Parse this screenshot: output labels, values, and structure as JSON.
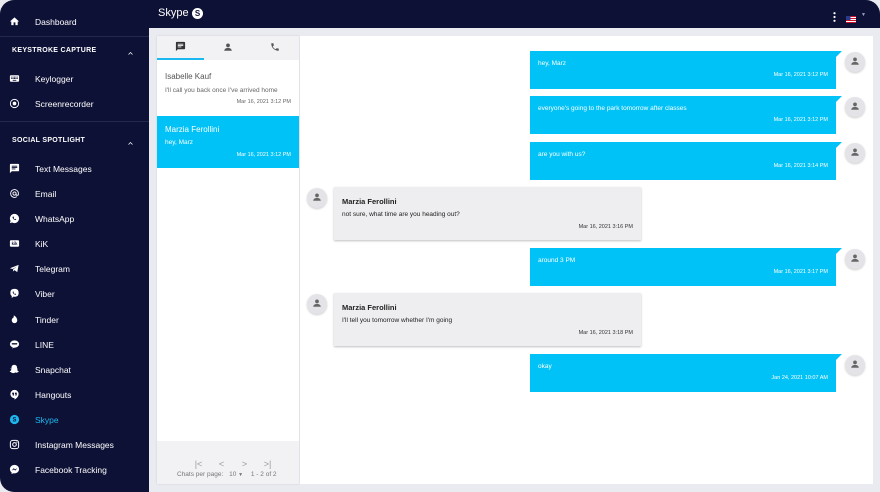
{
  "topbar": {
    "title": "Skype",
    "badge": "S"
  },
  "sidebar": {
    "dashboard": "Dashboard",
    "keystroke_section": "KEYSTROKE CAPTURE",
    "keylogger": "Keylogger",
    "screenrecorder": "Screenrecorder",
    "social_section": "SOCIAL SPOTLIGHT",
    "items": [
      {
        "label": "Text Messages",
        "icon": "message-icon"
      },
      {
        "label": "Email",
        "icon": "at-icon"
      },
      {
        "label": "WhatsApp",
        "icon": "whatsapp-icon"
      },
      {
        "label": "KiK",
        "icon": "kik-icon"
      },
      {
        "label": "Telegram",
        "icon": "telegram-icon"
      },
      {
        "label": "Viber",
        "icon": "viber-icon"
      },
      {
        "label": "Tinder",
        "icon": "tinder-icon"
      },
      {
        "label": "LINE",
        "icon": "line-icon"
      },
      {
        "label": "Snapchat",
        "icon": "snapchat-icon"
      },
      {
        "label": "Hangouts",
        "icon": "hangouts-icon"
      },
      {
        "label": "Skype",
        "icon": "skype-icon"
      },
      {
        "label": "Instagram Messages",
        "icon": "instagram-icon"
      },
      {
        "label": "Facebook Tracking",
        "icon": "messenger-icon"
      }
    ],
    "active_item": "Skype"
  },
  "chat_list": {
    "chats": [
      {
        "name": "Isabelle Kauf",
        "preview": "I'll call you back once I've arrived home",
        "time": "Mar 16, 2021 3:12 PM"
      },
      {
        "name": "Marzia Ferollini",
        "preview": "hey, Marz",
        "time": "Mar 16, 2021 3:12 PM"
      }
    ],
    "pager": {
      "per_page_label": "Chats per page:",
      "per_page": "10",
      "range": "1 - 2 of 2"
    }
  },
  "messages": [
    {
      "dir": "out",
      "text": "hey, Marz",
      "time": "Mar 16, 2021 3:12 PM"
    },
    {
      "dir": "out",
      "text": "everyone's going to the park tomorrow after classes",
      "time": "Mar 16, 2021 3:12 PM"
    },
    {
      "dir": "out",
      "text": "are you with us?",
      "time": "Mar 16, 2021 3:14 PM"
    },
    {
      "dir": "in",
      "sender": "Marzia Ferollini",
      "text": "not sure, what time are you heading out?",
      "time": "Mar 16, 2021 3:16 PM"
    },
    {
      "dir": "out",
      "text": "around 3 PM",
      "time": "Mar 16, 2021 3:17 PM"
    },
    {
      "dir": "in",
      "sender": "Marzia Ferollini",
      "text": "I'll tell you tomorrow whether I'm going",
      "time": "Mar 16, 2021 3:18 PM"
    },
    {
      "dir": "out",
      "text": "okay",
      "time": "Jan 24, 2021 10:07 AM"
    }
  ],
  "colors": {
    "navy": "#0e1136",
    "accent": "#1cb8f0",
    "bubble_out": "#00c2f7",
    "bubble_in": "#eeeef0"
  }
}
